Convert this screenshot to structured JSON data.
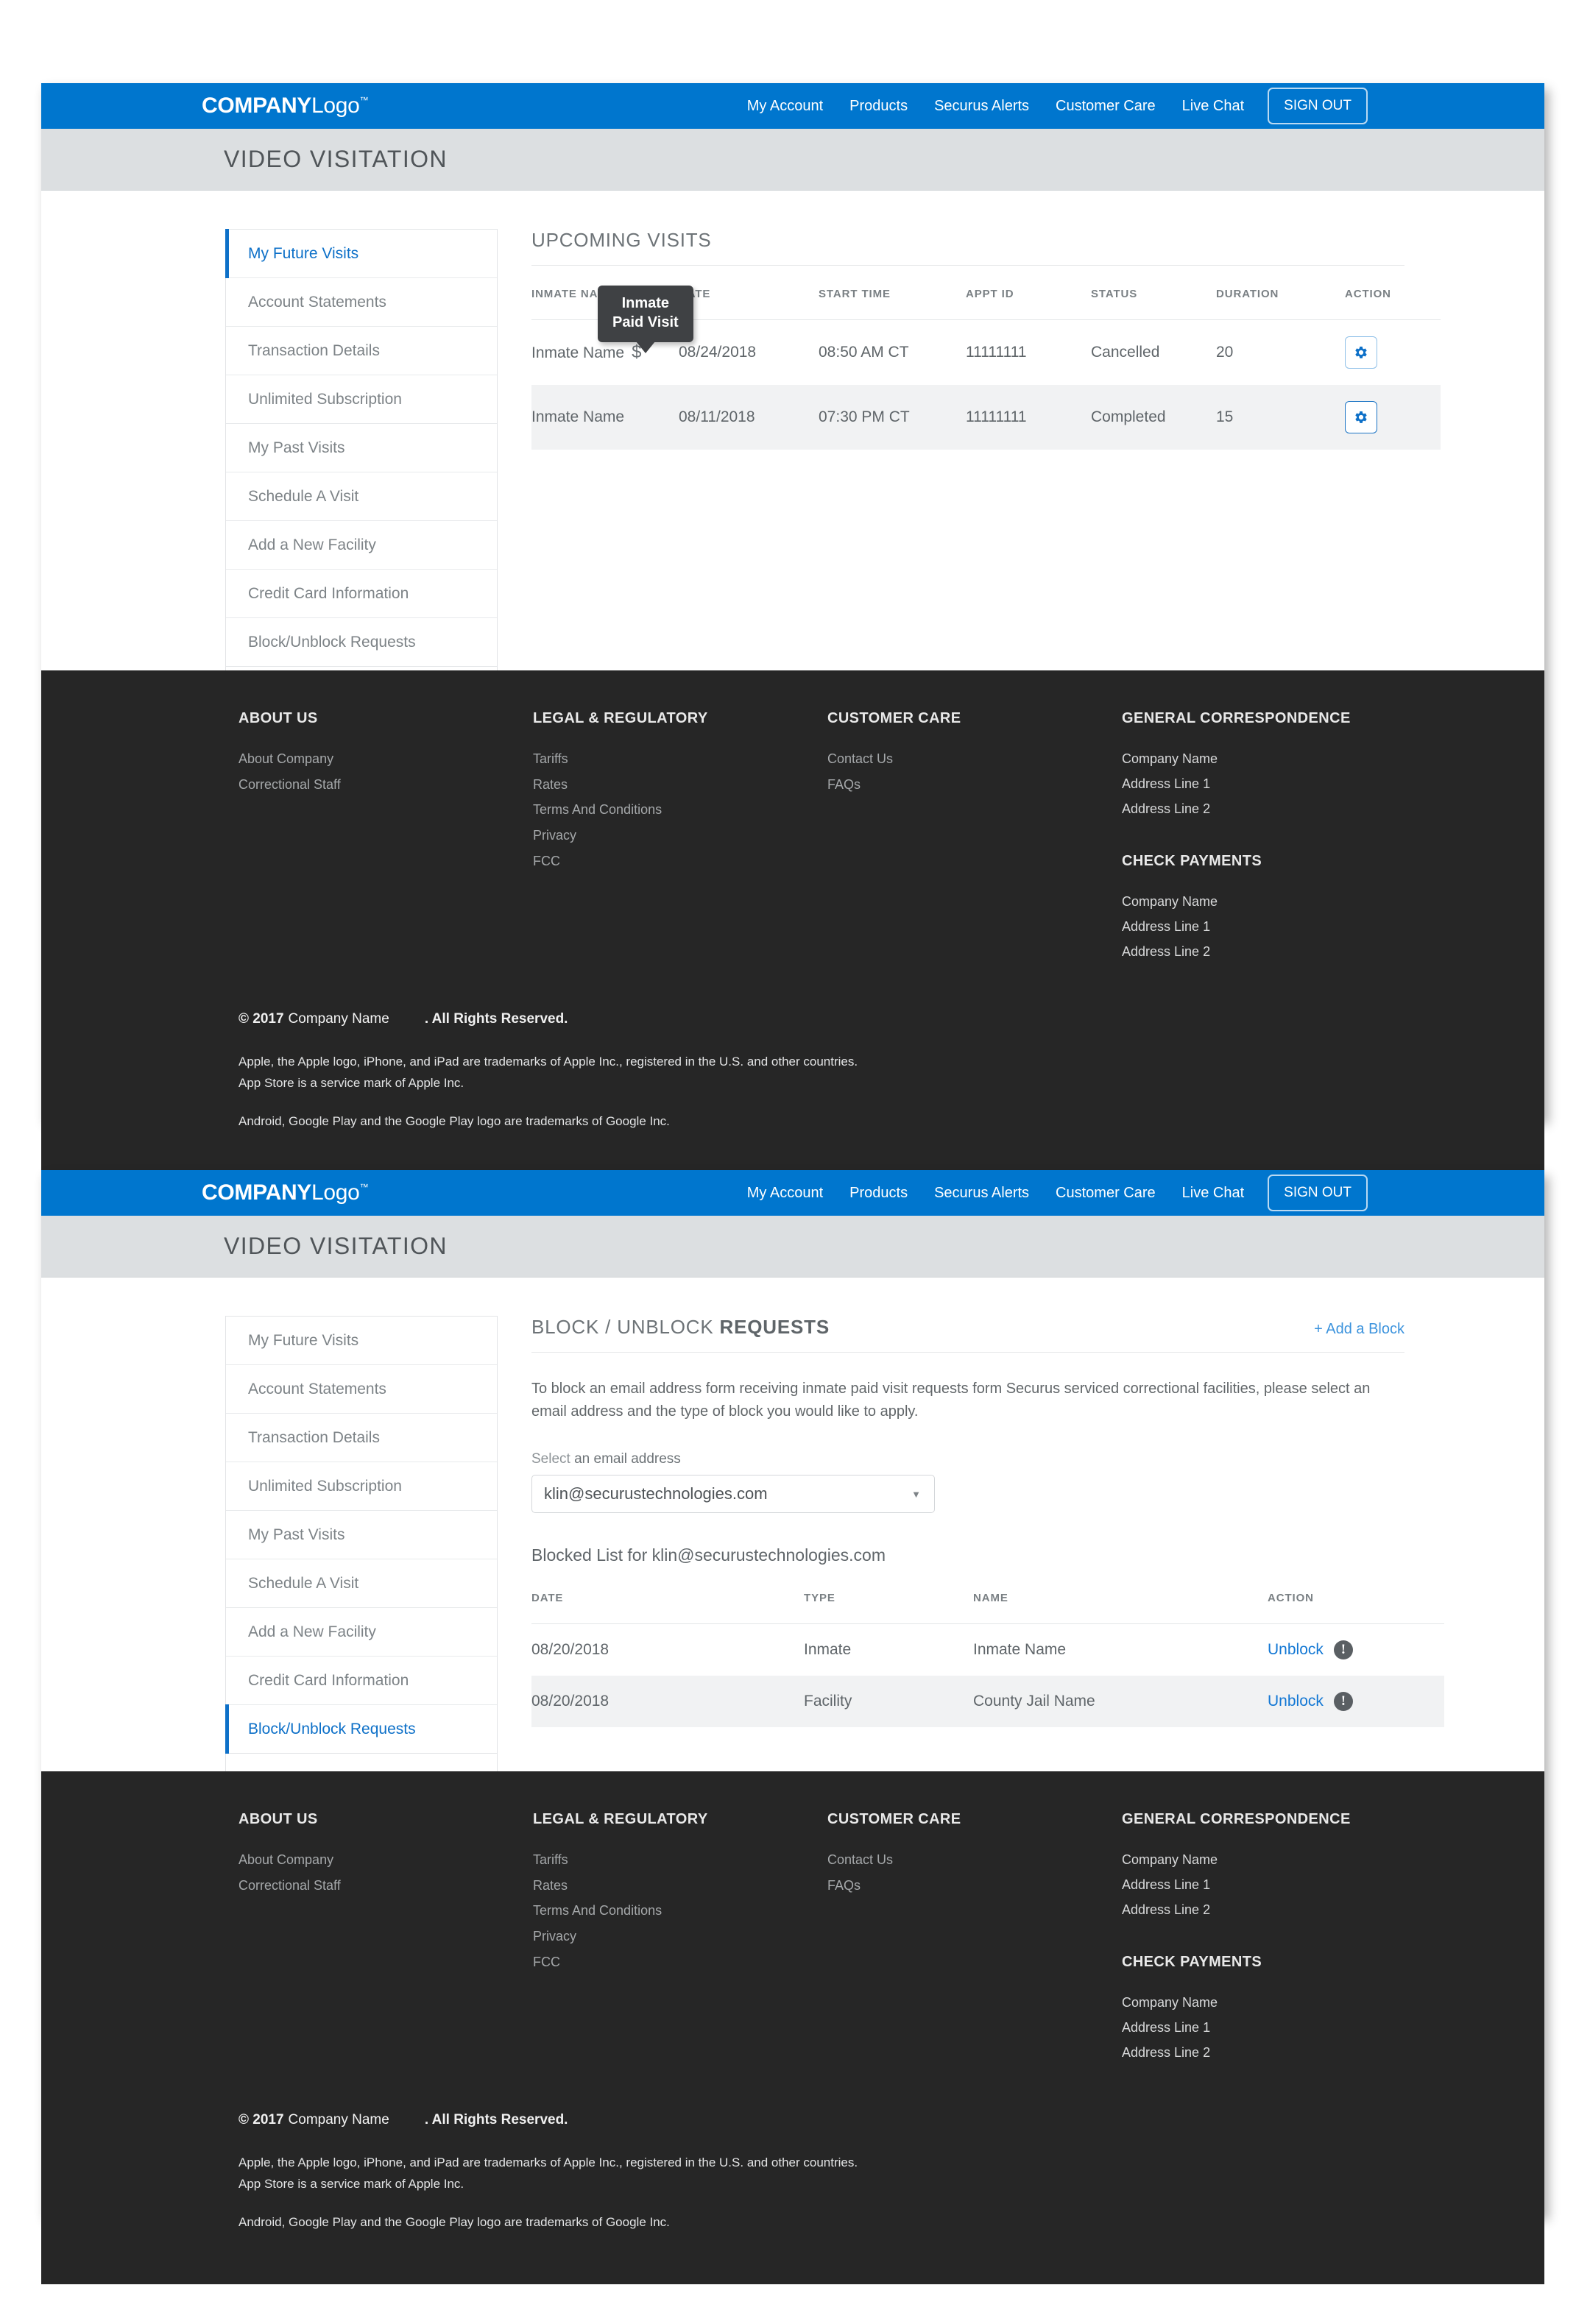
{
  "nav": {
    "brand_strong": "COMPANY",
    "brand_light": "Logo",
    "brand_tm": "™",
    "links": [
      {
        "label": "My Account"
      },
      {
        "label": "Products"
      },
      {
        "label": "Securus Alerts"
      },
      {
        "label": "Customer Care"
      },
      {
        "label": "Live Chat"
      }
    ],
    "signout_label": "SIGN OUT"
  },
  "subheader": {
    "title": "VIDEO VISITATION"
  },
  "sidebar": {
    "items": [
      {
        "label": "My Future Visits"
      },
      {
        "label": "Account Statements"
      },
      {
        "label": "Transaction Details"
      },
      {
        "label": "Unlimited Subscription"
      },
      {
        "label": "My Past Visits"
      },
      {
        "label": "Schedule A Visit"
      },
      {
        "label": "Add a New Facility"
      },
      {
        "label": "Credit Card Information"
      },
      {
        "label": "Block/Unblock Requests"
      }
    ]
  },
  "panel1": {
    "title": "UPCOMING VISITS",
    "tooltip_line1": "Inmate",
    "tooltip_line2": "Paid Visit",
    "paid_symbol": "$",
    "columns": [
      "INMATE NAME",
      "DATE",
      "START TIME",
      "APPT ID",
      "STATUS",
      "DURATION",
      "ACTION"
    ],
    "rows": [
      {
        "inmate_name": "Inmate Name",
        "paid": true,
        "date": "08/24/2018",
        "start_time": "08:50 AM CT",
        "appt_id": "11111111",
        "status": "Cancelled",
        "duration": "20",
        "action_icon": "gear-icon"
      },
      {
        "inmate_name": "Inmate Name",
        "paid": false,
        "date": "08/11/2018",
        "start_time": "07:30 PM CT",
        "appt_id": "11111111",
        "status": "Completed",
        "duration": "15",
        "action_icon": "gear-icon"
      }
    ]
  },
  "panel2": {
    "title_strong": "BLOCK / UNBLOCK",
    "title_rest": "REQUESTS",
    "add_block_label": "+ Add a Block",
    "intro": "To block an email address form receiving inmate paid visit requests form Securus serviced correctional facilities, please select an email address and the type of block you would like to apply.",
    "select_label_soft": "Select",
    "select_label_rest": "an email address",
    "select_value": "klin@securustechnologies.com",
    "select_caret": "▼",
    "blocked_title": "Blocked List for klin@securustechnologies.com",
    "columns": [
      "DATE",
      "TYPE",
      "NAME",
      "ACTION"
    ],
    "rows": [
      {
        "date": "08/20/2018",
        "type": "Inmate",
        "name": "Inmate Name",
        "action_label": "Unblock",
        "info_icon": "info-exclamation-icon",
        "info_glyph": "!"
      },
      {
        "date": "08/20/2018",
        "type": "Facility",
        "name": "County Jail Name",
        "action_label": "Unblock",
        "info_icon": "info-exclamation-icon",
        "info_glyph": "!"
      }
    ]
  },
  "footer": {
    "col1": {
      "head": "ABOUT US",
      "links": [
        {
          "label": "About Company"
        },
        {
          "label": "Correctional Staff"
        }
      ]
    },
    "col2": {
      "head": "LEGAL & REGULATORY",
      "links": [
        {
          "label": "Tariffs"
        },
        {
          "label": "Rates"
        },
        {
          "label": "Terms And Conditions"
        },
        {
          "label": "Privacy"
        },
        {
          "label": "FCC"
        }
      ]
    },
    "col3": {
      "head": "CUSTOMER CARE",
      "links": [
        {
          "label": "Contact Us"
        },
        {
          "label": "FAQs"
        }
      ]
    },
    "col4": {
      "head1": "GENERAL CORRESPONDENCE",
      "addr1": [
        {
          "label": "Company Name"
        },
        {
          "label": "Address Line 1"
        },
        {
          "label": "Address Line 2"
        }
      ],
      "head2": "CHECK PAYMENTS",
      "addr2": [
        {
          "label": "Company Name"
        },
        {
          "label": "Address Line 1"
        },
        {
          "label": "Address Line 2"
        }
      ]
    },
    "copyright_prefix": "© 2017",
    "copyright_company": "Company Name",
    "copyright_suffix": ". All Rights Reserved.",
    "legal": [
      "Apple, the Apple logo, iPhone, and iPad are trademarks of Apple Inc., registered in the U.S. and other countries.",
      "App Store is a service mark of Apple Inc.",
      "Android, Google Play and the Google Play logo are trademarks of Google Inc."
    ]
  },
  "colors": {
    "brand_blue": "#0076ce",
    "link_blue": "#1277d4",
    "subheader_gray": "#dcdfe1",
    "footer_dark": "#262626",
    "tooltip_dark": "#3f4144"
  }
}
